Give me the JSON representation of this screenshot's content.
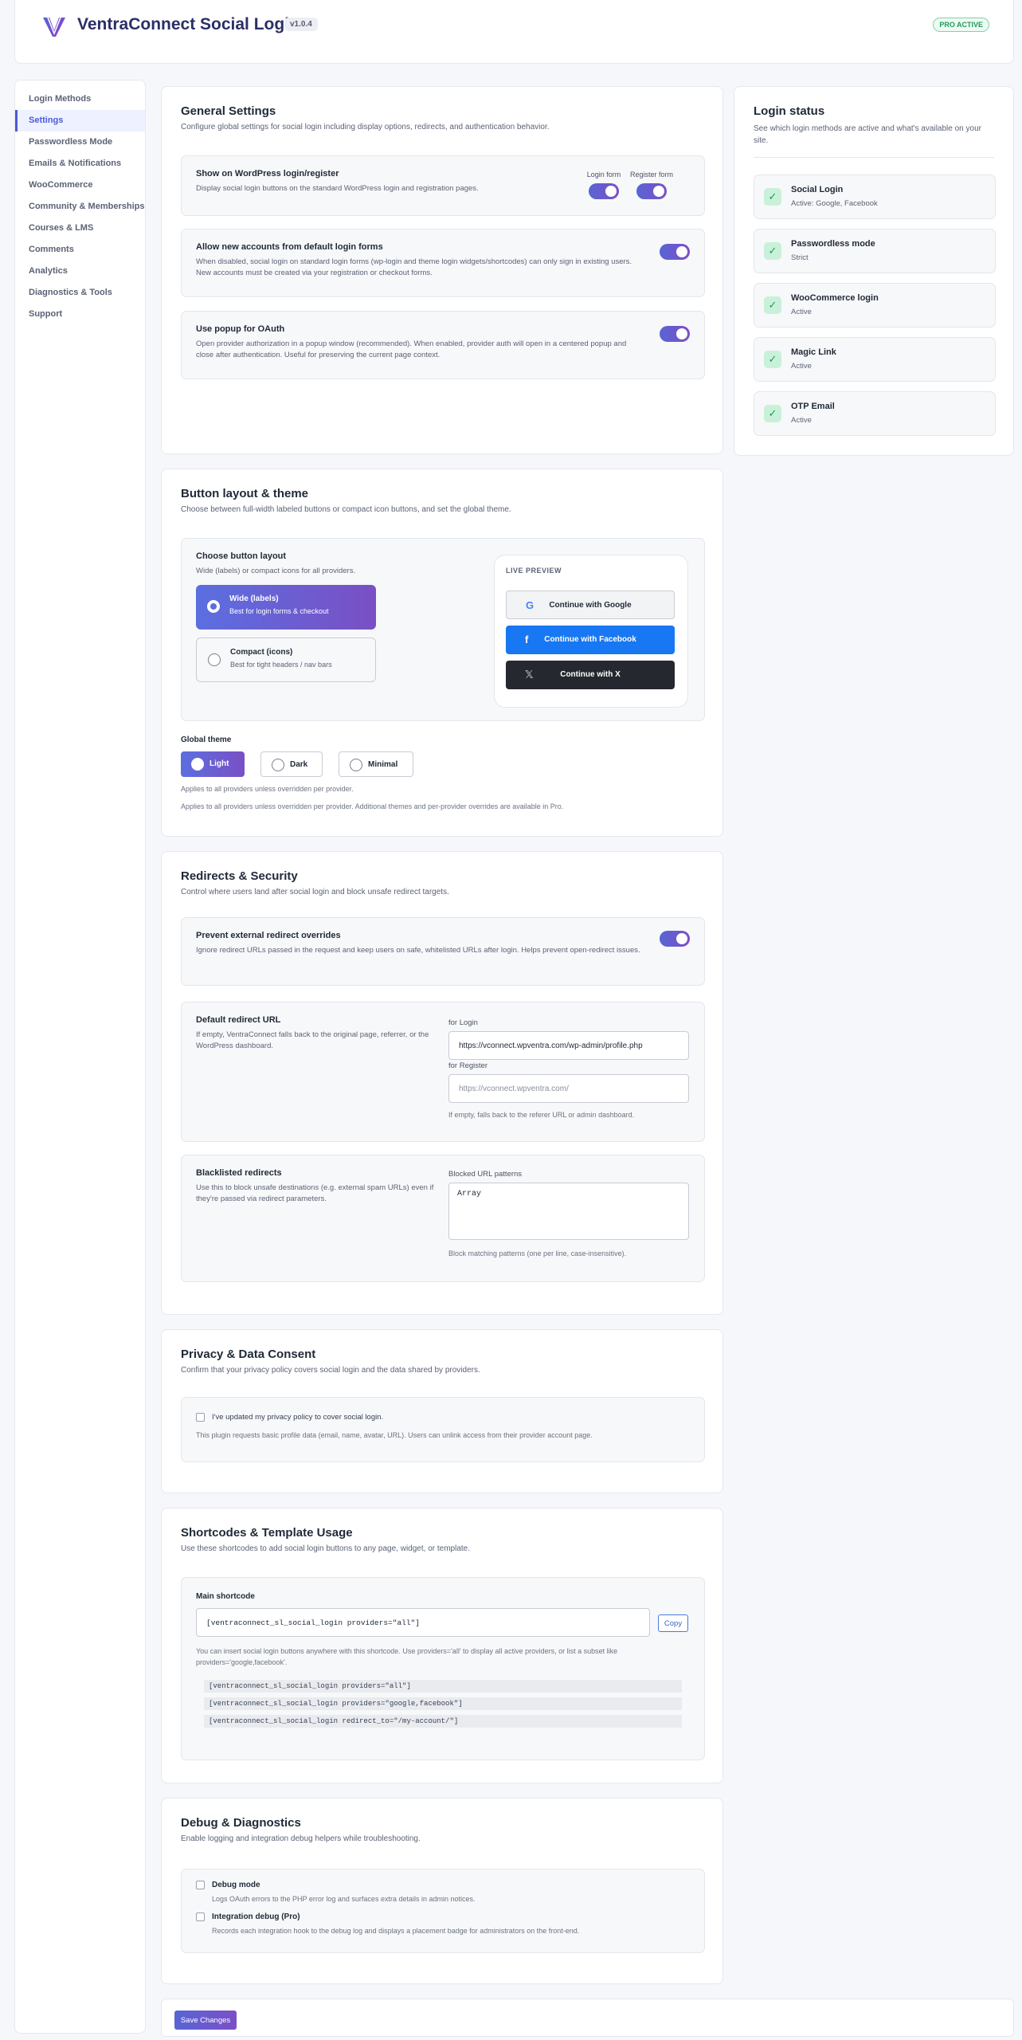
{
  "app": {
    "title": "VentraConnect Social Login",
    "version": "v1.0.4",
    "pro_badge": "PRO ACTIVE"
  },
  "sidebar": {
    "items": [
      {
        "label": "Login Methods",
        "active": false
      },
      {
        "label": "Settings",
        "active": true
      },
      {
        "label": "Passwordless Mode",
        "active": false
      },
      {
        "label": "Emails & Notifications",
        "active": false
      },
      {
        "label": "WooCommerce",
        "active": false
      },
      {
        "label": "Community & Memberships",
        "active": false
      },
      {
        "label": "Courses & LMS",
        "active": false
      },
      {
        "label": "Comments",
        "active": false
      },
      {
        "label": "Analytics",
        "active": false
      },
      {
        "label": "Diagnostics & Tools",
        "active": false
      },
      {
        "label": "Support",
        "active": false
      }
    ]
  },
  "general": {
    "title": "General Settings",
    "desc": "Configure global settings for social login including display options, redirects, and authentication behavior.",
    "show_on_wp": {
      "title": "Show on WordPress login/register",
      "desc": "Display social login buttons on the standard WordPress login and registration pages.",
      "login_label": "Login form",
      "register_label": "Register form",
      "login_on": true,
      "register_on": true
    },
    "allow_accounts": {
      "title": "Allow new accounts from default login forms",
      "desc": "When disabled, social login on standard login forms (wp-login and theme login widgets/shortcodes) can only sign in existing users. New accounts must be created via your registration or checkout forms.",
      "on": true
    },
    "popup": {
      "title": "Use popup for OAuth",
      "desc": "Open provider authorization in a popup window (recommended). When enabled, provider auth will open in a centered popup and close after authentication. Useful for preserving the current page context.",
      "on": true
    }
  },
  "status": {
    "title": "Login status",
    "desc": "See which login methods are active and what's available on your site.",
    "items": [
      {
        "name": "Social Login",
        "sub": "Active: Google, Facebook"
      },
      {
        "name": "Passwordless mode",
        "sub": "Strict"
      },
      {
        "name": "WooCommerce login",
        "sub": "Active"
      },
      {
        "name": "Magic Link",
        "sub": "Active"
      },
      {
        "name": "OTP Email",
        "sub": "Active"
      }
    ]
  },
  "layout": {
    "title": "Button layout & theme",
    "desc": "Choose between full-width labeled buttons or compact icon buttons, and set the global theme.",
    "choose_title": "Choose button layout",
    "choose_desc": "Wide (labels) or compact icons for all providers.",
    "wide": {
      "title": "Wide (labels)",
      "sub": "Best for login forms & checkout"
    },
    "compact": {
      "title": "Compact (icons)",
      "sub": "Best for tight headers / nav bars"
    },
    "preview_label": "LIVE PREVIEW",
    "preview_buttons": [
      {
        "label": "Continue with Google",
        "icon": "G"
      },
      {
        "label": "Continue with Facebook",
        "icon": "f"
      },
      {
        "label": "Continue with X",
        "icon": "𝕏"
      }
    ],
    "theme_title": "Global theme",
    "themes": [
      "Light",
      "Dark",
      "Minimal"
    ],
    "selected_theme": "Light",
    "theme_note1": "Applies to all providers unless overridden per provider.",
    "theme_note2": "Applies to all providers unless overridden per provider. Additional themes and per-provider overrides are available in Pro."
  },
  "redirects": {
    "title": "Redirects & Security",
    "desc": "Control where users land after social login and block unsafe redirect targets.",
    "prevent": {
      "title": "Prevent external redirect overrides",
      "desc": "Ignore redirect URLs passed in the request and keep users on safe, whitelisted URLs after login. Helps prevent open-redirect issues.",
      "on": true
    },
    "default": {
      "title": "Default redirect URL",
      "desc": "If empty, VentraConnect falls back to the original page, referrer, or the WordPress dashboard.",
      "login_label": "for Login",
      "login_value": "https://vconnect.wpventra.com/wp-admin/profile.php",
      "register_label": "for Register",
      "register_placeholder": "https://vconnect.wpventra.com/",
      "hint": "If empty, falls back to the referer URL or admin dashboard."
    },
    "blacklist": {
      "title": "Blacklisted redirects",
      "desc": "Use this to block unsafe destinations (e.g. external spam URLs) even if they're passed via redirect parameters.",
      "label": "Blocked URL patterns",
      "value": "Array",
      "hint": "Block matching patterns (one per line, case-insensitive)."
    }
  },
  "privacy": {
    "title": "Privacy & Data Consent",
    "desc": "Confirm that your privacy policy covers social login and the data shared by providers.",
    "check_label": "I've updated my privacy policy to cover social login.",
    "note": "This plugin requests basic profile data (email, name, avatar, URL). Users can unlink access from their provider account page."
  },
  "shortcodes": {
    "title": "Shortcodes & Template Usage",
    "desc": "Use these shortcodes to add social login buttons to any page, widget, or template.",
    "main_label": "Main shortcode",
    "main_value": "[ventraconnect_sl_social_login providers=\"all\"]",
    "copy_label": "Copy",
    "help": "You can insert social login buttons anywhere with this shortcode. Use providers='all' to display all active providers, or list a subset like providers='google,facebook'.",
    "examples": [
      "[ventraconnect_sl_social_login providers=\"all\"]",
      "[ventraconnect_sl_social_login providers=\"google,facebook\"]",
      "[ventraconnect_sl_social_login redirect_to=\"/my-account/\"]"
    ]
  },
  "debug": {
    "title": "Debug & Diagnostics",
    "desc": "Enable logging and integration debug helpers while troubleshooting.",
    "debug_mode": {
      "title": "Debug mode",
      "desc": "Logs OAuth errors to the PHP error log and surfaces extra details in admin notices."
    },
    "integration": {
      "title": "Integration debug (Pro)",
      "desc": "Records each integration hook to the debug log and displays a placement badge for administrators on the front-end."
    }
  },
  "footer": {
    "save_label": "Save Changes"
  },
  "colors": {
    "accent": "#5865d4",
    "accent2": "#7b4fc8",
    "success": "#1f9a5b",
    "facebook": "#1877f2",
    "x": "#25282e"
  }
}
